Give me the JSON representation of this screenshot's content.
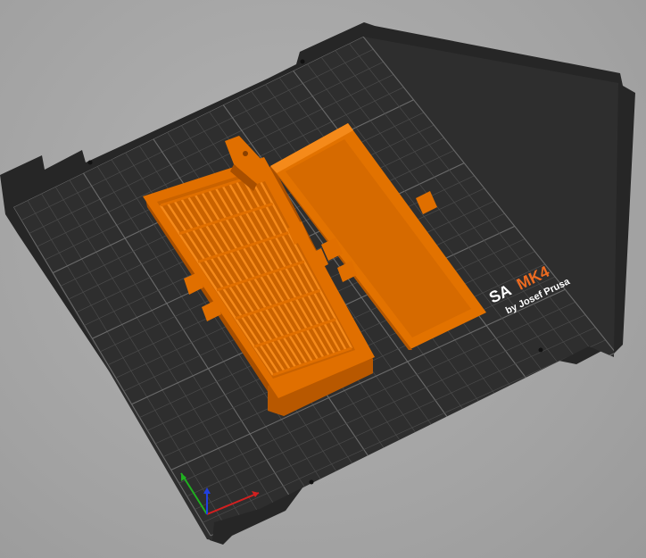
{
  "viewport": {
    "view": "3d-plater-view",
    "printer_bed": {
      "name": "MK4",
      "brand_text_prefix": "SA",
      "brand_text_model": "MK4",
      "brand_text_byline": "by Josef Prusa"
    },
    "objects": [
      {
        "name": "vent-grille-box",
        "color": "#e06f00"
      },
      {
        "name": "cover-lid",
        "color": "#e06f00"
      }
    ],
    "axes": {
      "x_color": "#d22020",
      "y_color": "#20b020",
      "z_color": "#2040e0"
    },
    "colors": {
      "background": "#a6a6a6",
      "bed": "#2c2c2c",
      "grid_major": "#6a6a6a",
      "grid_minor": "#4a4a4a",
      "object": "#e06f00",
      "object_shadow": "#b55700",
      "object_light": "#f58a1a",
      "accent": "#ed6b21"
    }
  }
}
